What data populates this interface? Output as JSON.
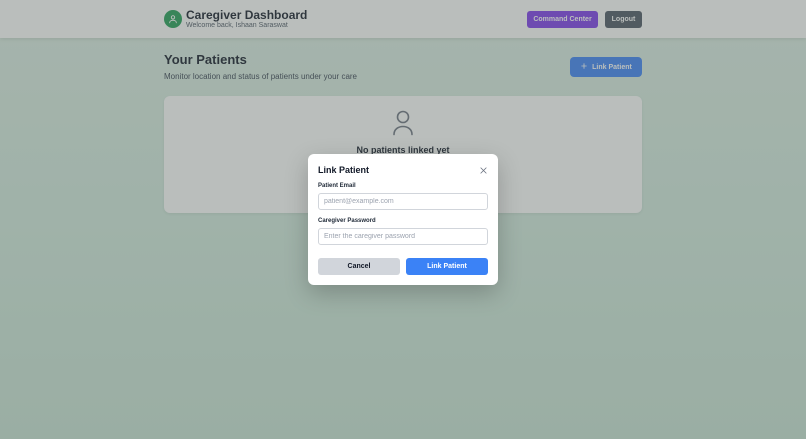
{
  "header": {
    "title": "Caregiver Dashboard",
    "subtitle": "Welcome back, Ishaan Saraswat",
    "command_center_label": "Command Center",
    "logout_label": "Logout",
    "avatar_icon": "user-icon"
  },
  "main": {
    "title": "Your Patients",
    "subtitle": "Monitor location and status of patients under your care",
    "link_patient_label": "Link Patient",
    "link_patient_icon": "plus-icon",
    "empty_state": {
      "icon": "user-icon",
      "text": "No patients linked yet"
    }
  },
  "modal": {
    "title": "Link Patient",
    "close_icon": "close-icon",
    "email_label": "Patient Email",
    "email_value": "",
    "email_placeholder": "patient@example.com",
    "password_label": "Caregiver Password",
    "password_value": "",
    "password_placeholder": "Enter the caregiver password",
    "cancel_label": "Cancel",
    "submit_label": "Link Patient"
  },
  "colors": {
    "accent_blue": "#3b82f6",
    "command_purple": "#7c3aed",
    "logout_gray": "#4b5563",
    "avatar_green": "#1f9d55"
  }
}
